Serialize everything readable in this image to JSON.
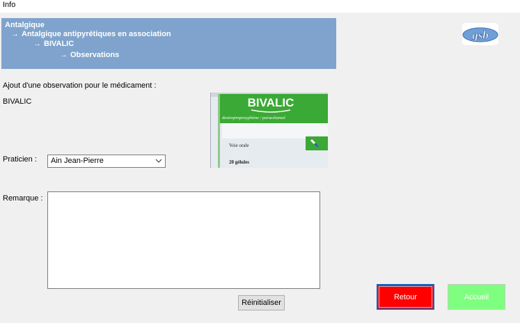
{
  "window": {
    "title": "Info"
  },
  "breadcrumb": {
    "level1": "Antalgique",
    "level2": "Antalgique antipyrétiques en association",
    "level3": "BIVALIC",
    "level4": "Observations",
    "arrow": "→"
  },
  "logo": {
    "text": "gsb"
  },
  "form": {
    "intro_label": "Ajout d'une observation pour le médicament :",
    "drug_name": "BIVALIC",
    "praticien_label": "Praticien :",
    "praticien_value": "Ain Jean-Pierre",
    "remarque_label": "Remarque :",
    "remarque_value": ""
  },
  "product_image": {
    "brand": "BIVALIC",
    "composition": "dextropropoxyphène / paracétamol",
    "route": "Voie orale",
    "quantity": "20 gélules"
  },
  "buttons": {
    "reset": "Réinitialiser",
    "retour": "Retour",
    "accueil": "Accueil"
  },
  "colors": {
    "breadcrumb_bg": "#7fa3cc",
    "retour_bg": "#ff0000",
    "accueil_bg": "#7fff7f",
    "box_green": "#3aa935"
  }
}
